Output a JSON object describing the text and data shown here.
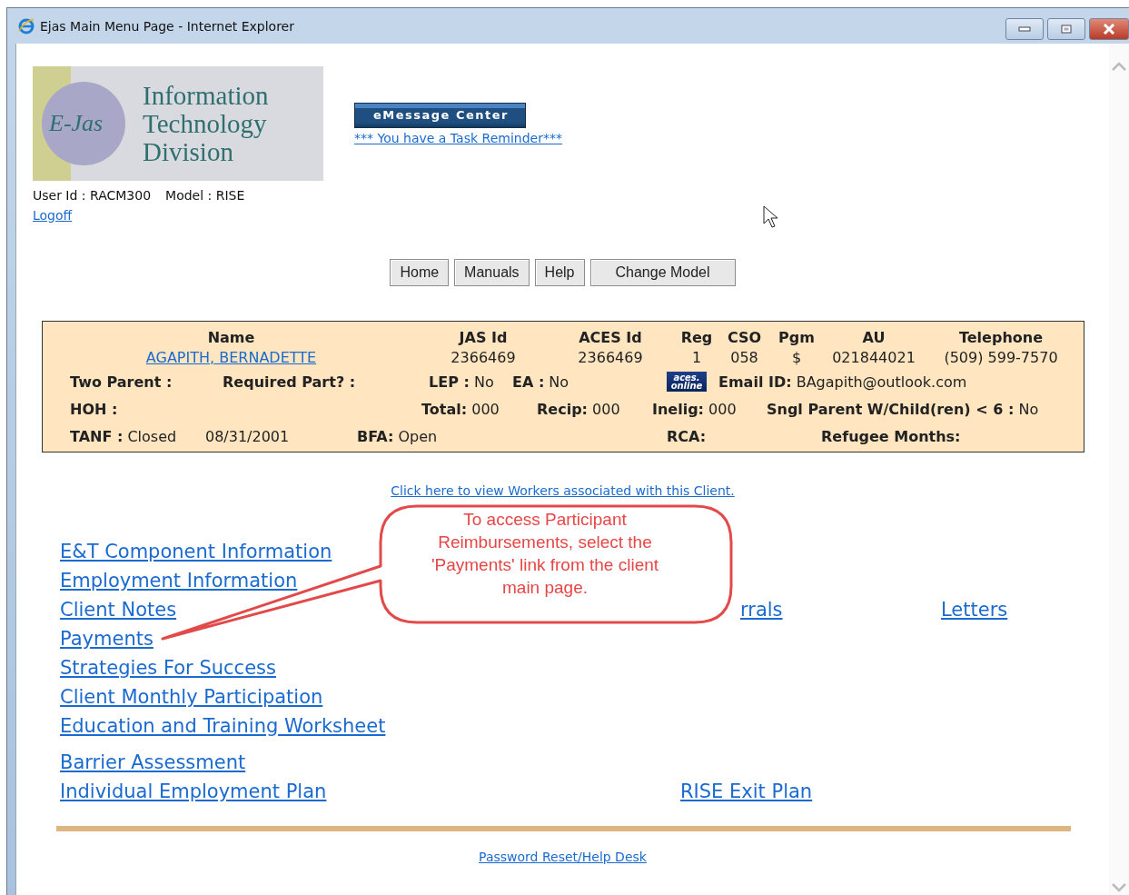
{
  "window": {
    "title": "Ejas Main Menu Page - Internet Explorer"
  },
  "logo": {
    "badge": "E-Jas",
    "lines": [
      "Information",
      "Technology",
      "Division"
    ]
  },
  "message_center": {
    "button": "eMessage Center",
    "reminder": "*** You have a Task Reminder***"
  },
  "user": {
    "user_id": "User Id : RACM300",
    "model": "Model : RISE",
    "logoff": "Logoff"
  },
  "nav_buttons": [
    "Home",
    "Manuals",
    "Help",
    "Change Model"
  ],
  "client": {
    "columns": [
      "Name",
      "JAS Id",
      "ACES Id",
      "Reg",
      "CSO",
      "Pgm",
      "AU",
      "Telephone"
    ],
    "values": [
      {
        "text": "AGAPITH, BERNADETTE",
        "kind": "link"
      },
      {
        "text": "2366469",
        "kind": "text"
      },
      {
        "text": "2366469",
        "kind": "text"
      },
      {
        "text": "1",
        "kind": "text"
      },
      {
        "text": "058",
        "kind": "text"
      },
      {
        "text": "$",
        "kind": "text"
      },
      {
        "text": "021844021",
        "kind": "text"
      },
      {
        "text": "(509) 599-7570",
        "kind": "text"
      }
    ],
    "lines": [
      [
        {
          "kind": "field",
          "text": "**Two Parent :**"
        },
        {
          "kind": "field",
          "text": "**Required Part? :**"
        },
        {
          "kind": "field",
          "text": "**LEP :** No"
        },
        {
          "kind": "field",
          "text": "**EA :** No"
        },
        {
          "kind": "icon",
          "text": "aces. online"
        },
        {
          "kind": "field",
          "text": "**Email ID:** BAgapith@outlook.com"
        }
      ],
      [
        {
          "kind": "field",
          "text": "**HOH :**"
        },
        {
          "kind": "field",
          "text": "**Total:** 000"
        },
        {
          "kind": "field",
          "text": "**Recip:** 000"
        },
        {
          "kind": "field",
          "text": "**Inelig:** 000"
        },
        {
          "kind": "field",
          "text": "**Sngl Parent W/Child(ren) < 6 :** No"
        }
      ],
      [
        {
          "kind": "field",
          "text": "**TANF :** Closed"
        },
        {
          "kind": "field",
          "text": "08/31/2001"
        },
        {
          "kind": "field",
          "text": "**BFA:** Open"
        },
        {
          "kind": "field",
          "text": "**RCA:**"
        },
        {
          "kind": "field",
          "text": "**Refugee Months:**"
        }
      ]
    ]
  },
  "workers_link": "Click here to view Workers associated with this Client.",
  "link_groups": [
    [
      {
        "left": "E&T Component Information"
      },
      {
        "left": "Employment Information"
      },
      {
        "left": "Client Notes",
        "middle": "rrals",
        "right": "Letters"
      },
      {
        "left": "Payments"
      },
      {
        "left": "Strategies For Success"
      },
      {
        "left": "Client Monthly Participation"
      },
      {
        "left": "Education and Training Worksheet"
      }
    ],
    [
      {
        "left": "Barrier Assessment"
      },
      {
        "left": "Individual Employment Plan",
        "middle": "RISE Exit Plan"
      }
    ]
  ],
  "callout": "To access Participant Reimbursements, select the 'Payments' link from the client main page.",
  "footer_link": "Password Reset/Help Desk"
}
